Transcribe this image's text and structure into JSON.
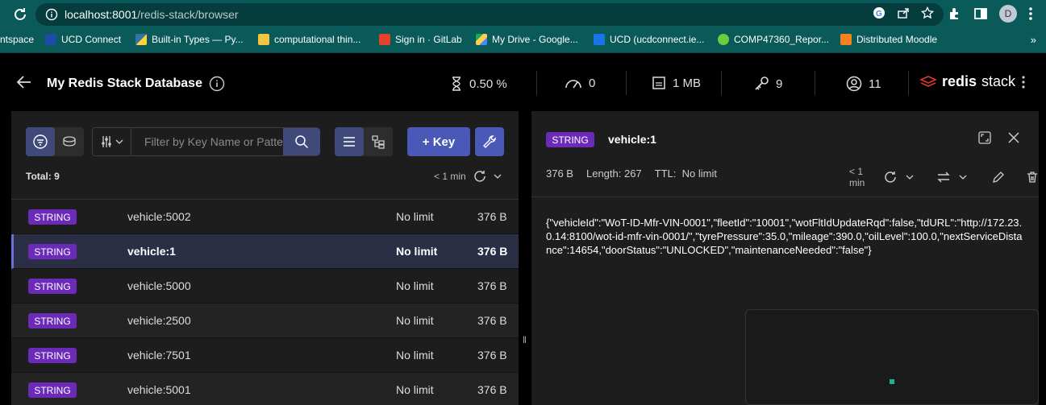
{
  "browser": {
    "url_host": "localhost:8001",
    "url_path": "/redis-stack/browser",
    "profile_initial": "D",
    "bookmarks": [
      {
        "label": "ntspace",
        "color": "#0a5a5a"
      },
      {
        "label": "UCD Connect",
        "color": "#1e4da8"
      },
      {
        "label": "Built-in Types — Py...",
        "color": "#3572a5"
      },
      {
        "label": "computational thin...",
        "color": "#f4c542"
      },
      {
        "label": "Sign in · GitLab",
        "color": "#e2432a"
      },
      {
        "label": "My Drive - Google...",
        "color": "#1fa463"
      },
      {
        "label": "UCD (ucdconnect.ie...",
        "color": "#1a73e8"
      },
      {
        "label": "COMP47360_Repor...",
        "color": "#6bcf3d"
      },
      {
        "label": "Distributed Moodle",
        "color": "#f58220"
      }
    ],
    "bookmarks_more": "»"
  },
  "header": {
    "title": "My Redis Stack Database",
    "stats": {
      "cpu": "0.50 %",
      "ops": "0",
      "memory": "1 MB",
      "keys": "9",
      "clients": "11"
    },
    "brand_bold": "redis",
    "brand_light": "stack"
  },
  "browser_panel": {
    "filter_placeholder": "Filter by Key Name or Pattern",
    "add_key_label": "+ Key",
    "total": "Total: 9",
    "refresh_age": "< 1 min",
    "rows": [
      {
        "type": "STRING",
        "key": "vehicle:5002",
        "ttl": "No limit",
        "size": "376 B",
        "selected": false
      },
      {
        "type": "STRING",
        "key": "vehicle:1",
        "ttl": "No limit",
        "size": "376 B",
        "selected": true
      },
      {
        "type": "STRING",
        "key": "vehicle:5000",
        "ttl": "No limit",
        "size": "376 B",
        "selected": false
      },
      {
        "type": "STRING",
        "key": "vehicle:2500",
        "ttl": "No limit",
        "size": "376 B",
        "selected": false
      },
      {
        "type": "STRING",
        "key": "vehicle:7501",
        "ttl": "No limit",
        "size": "376 B",
        "selected": false
      },
      {
        "type": "STRING",
        "key": "vehicle:5001",
        "ttl": "No limit",
        "size": "376 B",
        "selected": false
      }
    ]
  },
  "detail": {
    "type": "STRING",
    "key": "vehicle:1",
    "size": "376 B",
    "length": "Length: 267",
    "ttl_label": "TTL:",
    "ttl_value": "No limit",
    "refresh_age": "< 1 min",
    "value": "{\"vehicleId\":\"WoT-ID-Mfr-VIN-0001\",\"fleetId\":\"10001\",\"wotFltIdUpdateRqd\":false,\"tdURL\":\"http://172.23.0.14:8100/wot-id-mfr-vin-0001/\",\"tyrePressure\":35.0,\"mileage\":390.0,\"oilLevel\":100.0,\"nextServiceDistance\":14654,\"doorStatus\":\"UNLOCKED\",\"maintenanceNeeded\":\"false\"}"
  }
}
